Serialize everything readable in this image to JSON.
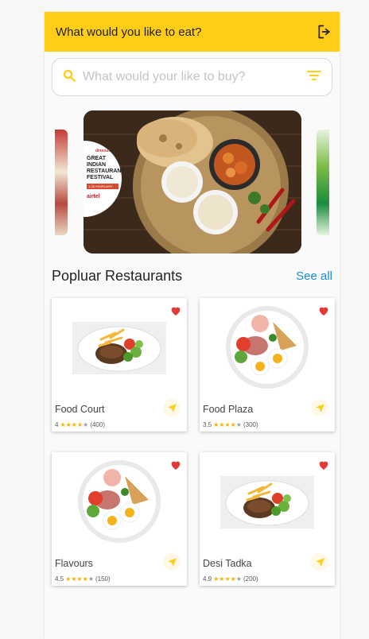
{
  "header": {
    "title": "What would you like to eat?",
    "logout_icon": "logout-icon"
  },
  "search": {
    "placeholder": "What would your like to buy?",
    "search_icon": "search-icon",
    "filter_icon": "filter-icon"
  },
  "banner": {
    "brand": "dineout",
    "event": "GREAT INDIAN RESTAURANT FESTIVAL",
    "date": "1-28 FEBRUARY",
    "sponsor": "airtel"
  },
  "section": {
    "title": "Popluar Restaurants",
    "see_all": "See all"
  },
  "colors": {
    "accent": "#ffcc17",
    "link": "#1a8cd8",
    "heart": "#e53935",
    "star": "#f5b400"
  },
  "restaurants": [
    {
      "name": "Food Court",
      "rating": "4",
      "stars": 4,
      "reviews": "(400)",
      "dish": "steak"
    },
    {
      "name": "Food Plaza",
      "rating": "3.5",
      "stars": 4,
      "reviews": "(300)",
      "dish": "breakfast"
    },
    {
      "name": "Flavours",
      "rating": "4.5",
      "stars": 4,
      "reviews": "(150)",
      "dish": "breakfast"
    },
    {
      "name": "Desi Tadka",
      "rating": "4.9",
      "stars": 4,
      "reviews": "(200)",
      "dish": "steak"
    }
  ]
}
